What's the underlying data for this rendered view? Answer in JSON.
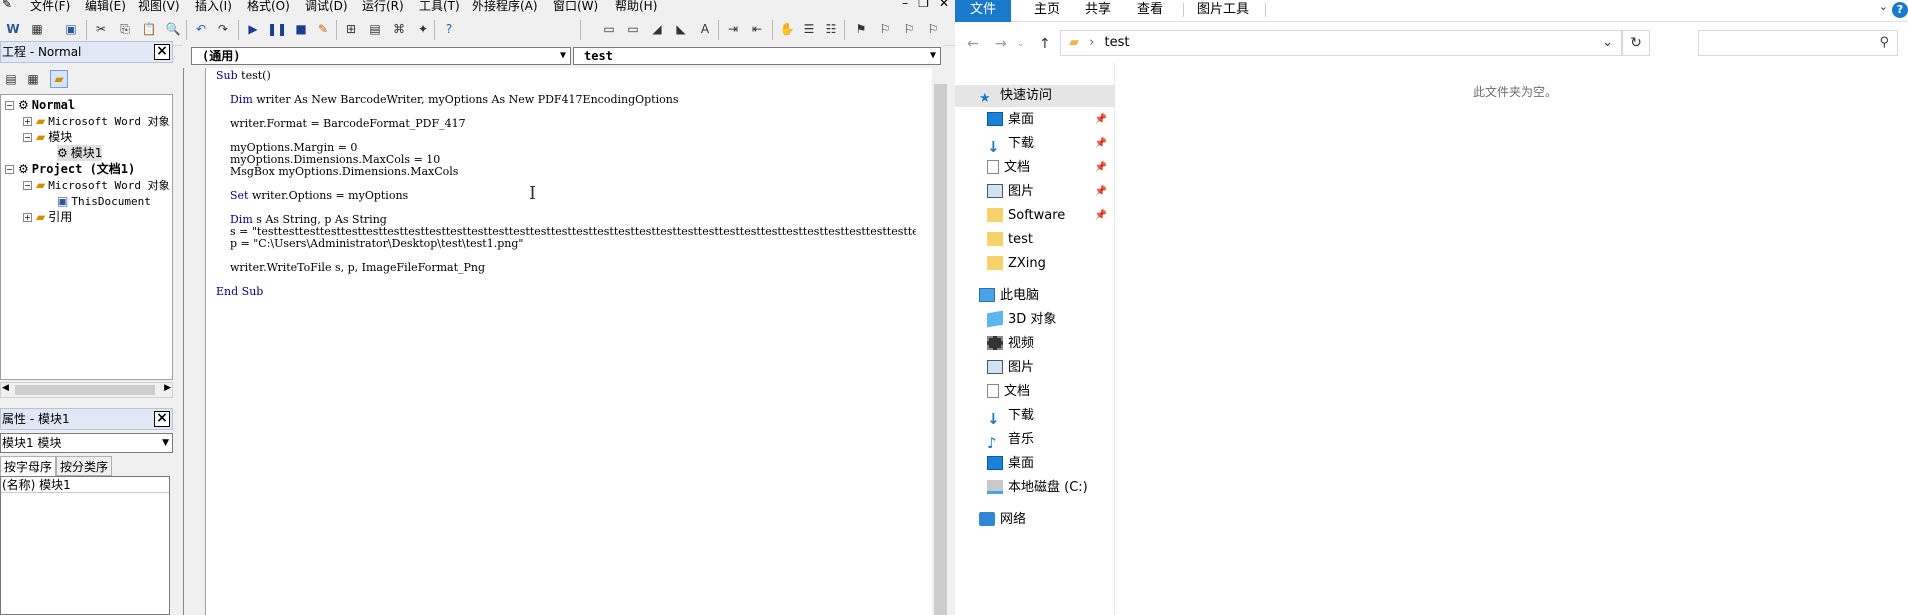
{
  "vbe": {
    "menus": [
      "文件(F)",
      "编辑(E)",
      "视图(V)",
      "插入(I)",
      "格式(O)",
      "调试(D)",
      "运行(R)",
      "工具(T)",
      "外接程序(A)",
      "窗口(W)",
      "帮助(H)"
    ],
    "project_title": "工程 - Normal",
    "tree": {
      "normal": "Normal",
      "ms_word_objects": "Microsoft Word 对象",
      "modules": "模块",
      "module1": "模块1",
      "project": "Project (文档1)",
      "ms_word_objects2": "Microsoft Word 对象",
      "this_document": "ThisDocument",
      "references": "引用"
    },
    "props_title": "属性 - 模块1",
    "props_combo": "模块1 模块",
    "tab_alpha": "按字母序",
    "tab_category": "按分类序",
    "prop_row": "(名称) 模块1",
    "proc_combo_left": "(通用)",
    "proc_combo_right": "test",
    "code_lines": [
      {
        "kw": "Sub",
        "rest": " test()"
      },
      {
        "kw": "",
        "rest": ""
      },
      {
        "kw": "    Dim",
        "rest": " writer As New BarcodeWriter, myOptions As New PDF417EncodingOptions"
      },
      {
        "kw": "",
        "rest": ""
      },
      {
        "kw": "",
        "rest": "    writer.Format = BarcodeFormat_PDF_417"
      },
      {
        "kw": "",
        "rest": ""
      },
      {
        "kw": "",
        "rest": "    myOptions.Margin = 0"
      },
      {
        "kw": "",
        "rest": "    myOptions.Dimensions.MaxCols = 10"
      },
      {
        "kw": "",
        "rest": "    MsgBox myOptions.Dimensions.MaxCols"
      },
      {
        "kw": "",
        "rest": ""
      },
      {
        "kw": "    Set",
        "rest": " writer.Options = myOptions"
      },
      {
        "kw": "",
        "rest": ""
      },
      {
        "kw": "    Dim",
        "rest": " s As String, p As String"
      },
      {
        "kw": "",
        "rest": "    s = \"testtesttesttesttesttesttesttesttesttesttesttesttesttesttesttesttesttesttesttesttesttesttesttesttesttesttesttesttesttesttesttesttest"
      },
      {
        "kw": "",
        "rest": "    p = \"C:\\Users\\Administrator\\Desktop\\test\\test1.png\""
      },
      {
        "kw": "",
        "rest": ""
      },
      {
        "kw": "",
        "rest": "    writer.WriteToFile s, p, ImageFileFormat_Png"
      },
      {
        "kw": "",
        "rest": ""
      },
      {
        "kw": "End Sub",
        "rest": ""
      }
    ]
  },
  "explorer": {
    "tabs": [
      "文件",
      "主页",
      "共享",
      "查看",
      "图片工具"
    ],
    "address": "test",
    "empty_message": "此文件夹为空。",
    "nav": {
      "quick_access": "快速访问",
      "desktop": "桌面",
      "downloads": "下载",
      "documents": "文档",
      "pictures": "图片",
      "software": "Software",
      "test": "test",
      "zxing": "ZXing",
      "this_pc": "此电脑",
      "objects3d": "3D 对象",
      "videos": "视频",
      "pictures2": "图片",
      "documents2": "文档",
      "downloads2": "下载",
      "music": "音乐",
      "desktop2": "桌面",
      "local_disk": "本地磁盘 (C:)",
      "network": "网络"
    }
  }
}
